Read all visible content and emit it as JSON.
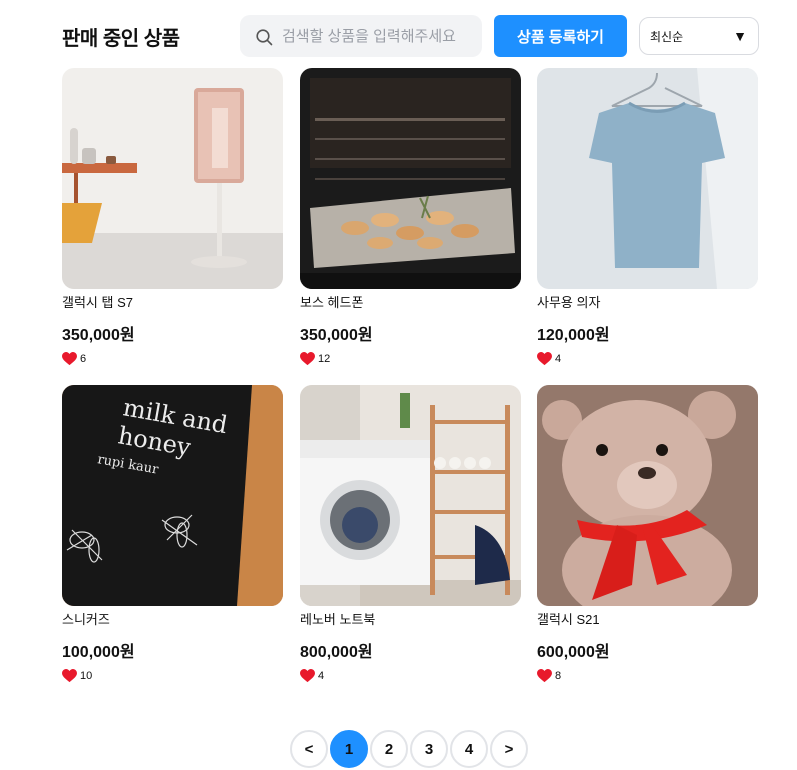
{
  "header": {
    "title": "판매 중인 상품",
    "search_placeholder": "검색할 상품을 입력해주세요",
    "register_label": "상품 등록하기",
    "sort_selected": "최신순",
    "sort_arrow": "▼"
  },
  "products": [
    {
      "name": "갤럭시 탭 S7",
      "price": "350,000원",
      "likes": "6",
      "image": "standing-display-photo"
    },
    {
      "name": "보스 헤드폰",
      "price": "350,000원",
      "likes": "12",
      "image": "oven-bread-photo"
    },
    {
      "name": "사무용 의자",
      "price": "120,000원",
      "likes": "4",
      "image": "tshirt-hanger-photo"
    },
    {
      "name": "스니커즈",
      "price": "100,000원",
      "likes": "10",
      "image": "book-cover-photo"
    },
    {
      "name": "레노버 노트북",
      "price": "800,000원",
      "likes": "4",
      "image": "washing-machine-photo"
    },
    {
      "name": "갤럭시 S21",
      "price": "600,000원",
      "likes": "8",
      "image": "teddy-bear-photo"
    }
  ],
  "book_cover": {
    "title_line1": "milk and",
    "title_line2": "honey",
    "author": "rupi kaur"
  },
  "pagination": {
    "prev": "<",
    "pages": [
      "1",
      "2",
      "3",
      "4"
    ],
    "next": ">",
    "current": "1"
  },
  "colors": {
    "accent": "#1e90ff",
    "heart": "#e8192c",
    "search_bg": "#f2f3f5"
  }
}
